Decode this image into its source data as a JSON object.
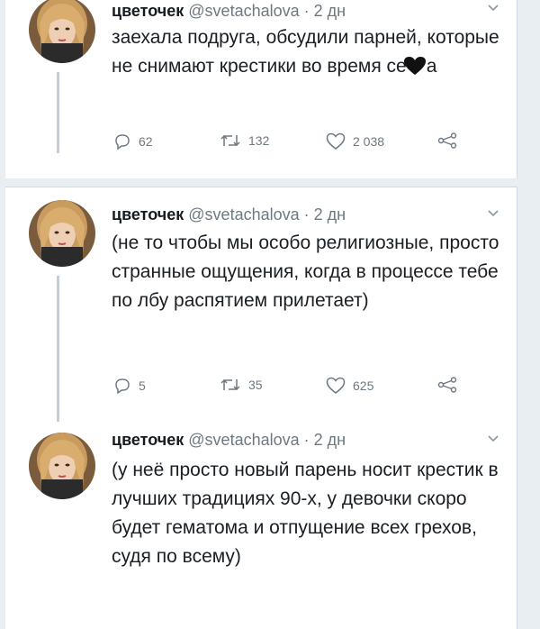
{
  "tweets": [
    {
      "name": "цветочек",
      "handle": "@svetachalova",
      "time": "· 2 дн",
      "text": "заехала подруга, обсудили парней, которые не снимают крестики во время се",
      "text_tail": "а",
      "stats": {
        "replies": "62",
        "retweets": "132",
        "likes": "2 038"
      }
    },
    {
      "name": "цветочек",
      "handle": "@svetachalova",
      "time": "· 2 дн",
      "text": "(не то чтобы мы особо религиозные, просто странные ощущения, когда в процессе тебе по лбу распятием прилетает)",
      "stats": {
        "replies": "5",
        "retweets": "35",
        "likes": "625"
      }
    },
    {
      "name": "цветочек",
      "handle": "@svetachalova",
      "time": "· 2 дн",
      "text": "(у неё просто новый парень носит крестик в лучших традициях 90-х, у девочки скоро будет гематома и отпущение всех грехов, судя по всему)"
    }
  ],
  "icons": {
    "reply": "reply-icon",
    "retweet": "retweet-icon",
    "like": "heart-icon",
    "share": "share-icon",
    "more": "chevron-down-icon",
    "emoji": "black-heart-icon"
  },
  "colors": {
    "background": "#e9eef3",
    "card": "#ffffff",
    "muted": "#6e7881",
    "text": "#1a1f24"
  }
}
